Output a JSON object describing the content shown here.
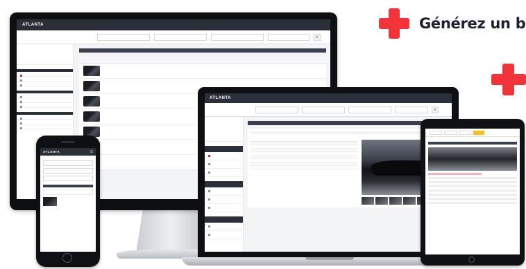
{
  "headline": {
    "text": "Générez un bo",
    "accent_color": "#f2333a"
  },
  "desktop": {
    "logo": "ATLANTA",
    "account": "",
    "search_label": "",
    "selects": [
      "",
      "",
      ""
    ],
    "section_title": "",
    "sidebar_sections": [
      {
        "title": "",
        "items": [
          "",
          "",
          ""
        ]
      },
      {
        "title": "",
        "items": [
          "",
          "",
          ""
        ]
      },
      {
        "title": "",
        "items": [
          "",
          "",
          ""
        ]
      }
    ],
    "rows": [
      {
        "title": "",
        "sub": ""
      },
      {
        "title": "",
        "sub": ""
      },
      {
        "title": "",
        "sub": ""
      },
      {
        "title": "",
        "sub": ""
      },
      {
        "title": "",
        "sub": ""
      },
      {
        "title": "",
        "sub": ""
      },
      {
        "title": "",
        "sub": ""
      }
    ]
  },
  "laptop": {
    "logo": "ATLANTA",
    "account": "",
    "search_label": "",
    "section_title": "",
    "card_head": "",
    "listing_title": "",
    "listing_sub": "",
    "price": "",
    "warning": "",
    "spec_rows": [
      {
        "k": "",
        "v": ""
      },
      {
        "k": "",
        "v": ""
      },
      {
        "k": "",
        "v": ""
      },
      {
        "k": "",
        "v": ""
      },
      {
        "k": "",
        "v": ""
      },
      {
        "k": "",
        "v": ""
      },
      {
        "k": "",
        "v": ""
      },
      {
        "k": "",
        "v": ""
      }
    ]
  },
  "tablet": {
    "logo": "",
    "title": "",
    "warning": ""
  },
  "phone": {
    "logo": "ATLANTA",
    "search_label": "",
    "selects": [
      "",
      "",
      ""
    ],
    "section_bar": "",
    "card_text": "",
    "item_title": ""
  }
}
